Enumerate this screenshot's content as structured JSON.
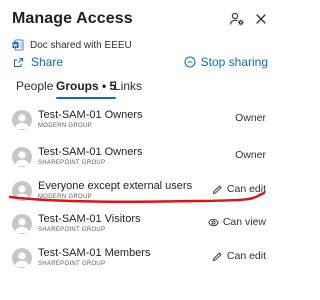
{
  "header": {
    "title": "Manage Access",
    "settings_icon": "people-settings-icon",
    "close_icon": "close-icon"
  },
  "document": {
    "icon": "word-doc-icon",
    "shared_text": "Doc shared with EEEU"
  },
  "actions": {
    "share_label": "Share",
    "stop_sharing_label": "Stop sharing"
  },
  "tabs": [
    {
      "label": "People"
    },
    {
      "label": "Groups • 5",
      "selected": true
    },
    {
      "label": "Links"
    }
  ],
  "groups": [
    {
      "name": "Test-SAM-01 Owners",
      "type": "MODERN GROUP",
      "permission": "Owner",
      "permission_icon": ""
    },
    {
      "name": "Test-SAM-01 Owners",
      "type": "SHAREPOINT GROUP",
      "permission": "Owner",
      "permission_icon": ""
    },
    {
      "name": "Everyone except external users",
      "type": "MODERN GROUP",
      "permission": "Can edit",
      "permission_icon": "pencil-icon"
    },
    {
      "name": "Test-SAM-01 Visitors",
      "type": "SHAREPOINT GROUP",
      "permission": "Can view",
      "permission_icon": "eye-icon"
    },
    {
      "name": "Test-SAM-01 Members",
      "type": "SHAREPOINT GROUP",
      "permission": "Can edit",
      "permission_icon": "pencil-icon"
    }
  ],
  "colors": {
    "accent": "#0f6cbd",
    "annotation": "#d9151b",
    "avatar": "#c8c6c4"
  }
}
